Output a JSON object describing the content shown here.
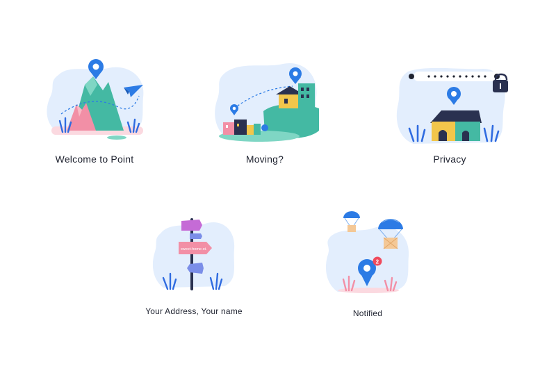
{
  "cards": [
    {
      "title": "Welcome to Point",
      "icon": "map-pin-mountains-illustration"
    },
    {
      "title": "Moving?",
      "icon": "houses-moving-illustration"
    },
    {
      "title": "Privacy",
      "icon": "house-password-lock-illustration"
    },
    {
      "title": "Your Address, Your name",
      "icon": "signpost-illustration",
      "sign_text": "sweet-home-st."
    },
    {
      "title": "Notified",
      "icon": "notification-pin-parachute-illustration",
      "badge_count": "2"
    }
  ],
  "colors": {
    "blob": "#e3eefd",
    "pin_blue": "#2c7be5",
    "teal": "#44b9a3",
    "pink": "#f28fa6",
    "grass_blue": "#2f6be0",
    "house_yellow": "#f2c64b",
    "roof_navy": "#2a3150"
  }
}
